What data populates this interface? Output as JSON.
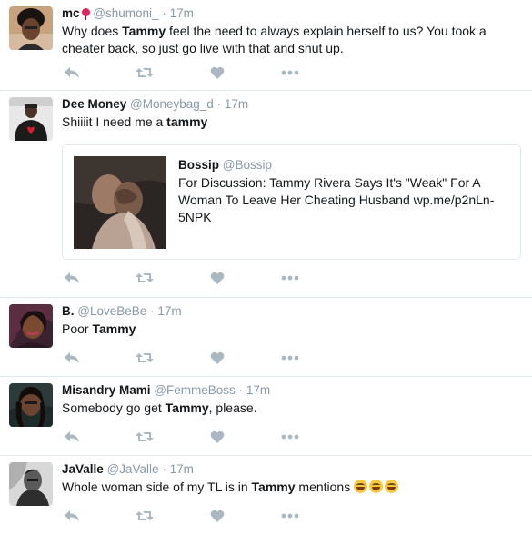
{
  "tweets": [
    {
      "name": "mc",
      "handle": "@shumoni_",
      "time": "17m",
      "text_parts": [
        {
          "t": "Why does ",
          "b": false
        },
        {
          "t": "Tammy",
          "b": true
        },
        {
          "t": " feel the need to always explain herself to us? You took a cheater back, so just go live with that and shut up.",
          "b": false
        }
      ]
    },
    {
      "name": "Dee Money",
      "handle": "@Moneybag_d",
      "time": "17m",
      "text_parts": [
        {
          "t": "Shiiiit I need me a ",
          "b": false
        },
        {
          "t": "tammy",
          "b": true
        }
      ],
      "card": {
        "name": "Bossip",
        "handle": "@Bossip",
        "text": "For Discussion: Tammy Rivera Says It's \"Weak\" For A Woman To Leave Her Cheating Husband wp.me/p2nLn-5NPK"
      }
    },
    {
      "name": "B.",
      "handle": "@LoveBeBe",
      "time": "17m",
      "text_parts": [
        {
          "t": "Poor ",
          "b": false
        },
        {
          "t": "Tammy",
          "b": true
        }
      ]
    },
    {
      "name": "Misandry Mami",
      "handle": "@FemmeBoss",
      "time": "17m",
      "text_parts": [
        {
          "t": "Somebody go get ",
          "b": false
        },
        {
          "t": "Tammy",
          "b": true
        },
        {
          "t": ", please.",
          "b": false
        }
      ]
    },
    {
      "name": "JaValle",
      "handle": "@JaValle",
      "time": "17m",
      "text_parts": [
        {
          "t": "Whole woman side of my TL is in ",
          "b": false
        },
        {
          "t": "Tammy",
          "b": true
        },
        {
          "t": " mentions ",
          "b": false
        }
      ],
      "emoji_count": 3
    }
  ],
  "separator": "·",
  "icons": [
    "reply-icon",
    "retweet-icon",
    "like-icon",
    "more-icon"
  ],
  "colors": {
    "icon": "#aab8c2",
    "muted": "#8899a6",
    "text": "#14171a",
    "border": "#e1e8ed"
  }
}
